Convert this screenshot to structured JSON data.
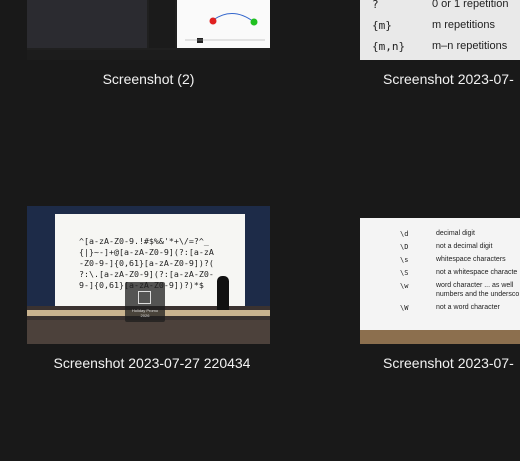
{
  "tiles": [
    {
      "caption": "Screenshot (2)"
    },
    {
      "caption": "Screenshot 2023-07-",
      "slide_rows": [
        {
          "token": "?",
          "desc": "0 or 1 repetition"
        },
        {
          "token": "{m}",
          "desc": "m repetitions"
        },
        {
          "token": "{m,n}",
          "desc": "m–n repetitions"
        }
      ]
    },
    {
      "caption": "Screenshot 2023-07-27 220434",
      "code_lines": [
        "^[a-zA-Z0-9.!#$%&'*+\\/=?^_",
        "{|}~-]+@[a-zA-Z0-9](?:[a-zA",
        "-Z0-9-]{0,61}[a-zA-Z0-9])?(",
        "?:\\.[a-zA-Z0-9](?:[a-zA-Z0-",
        "9-]{0,61}[a-zA-Z0-9])?)*$"
      ],
      "overlay_label": "Holiday Promo",
      "overlay_sub": "2026"
    },
    {
      "caption": "Screenshot 2023-07-",
      "slide_rows": [
        {
          "token": "\\d",
          "desc": "decimal digit"
        },
        {
          "token": "\\D",
          "desc": "not a decimal digit"
        },
        {
          "token": "\\s",
          "desc": "whitespace characters"
        },
        {
          "token": "\\S",
          "desc": "not a whitespace characte"
        },
        {
          "token": "\\w",
          "desc": "word character ... as well"
        },
        {
          "token": "",
          "desc": "numbers and the undersco"
        },
        {
          "token": "\\W",
          "desc": "not a word character"
        }
      ]
    }
  ]
}
